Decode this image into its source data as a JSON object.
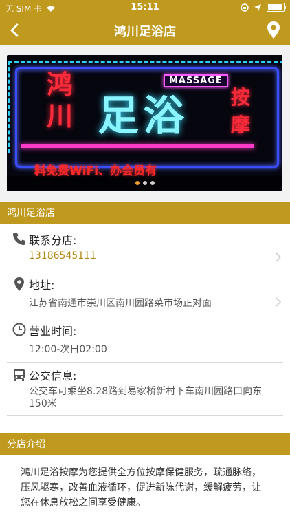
{
  "status_bar": {
    "carrier": "无 SIM 卡",
    "time": "15:11"
  },
  "nav": {
    "title": "鸿川足浴店"
  },
  "banner": {
    "sign_left": "鸿川",
    "sign_main": "足浴",
    "sign_right": "按摩",
    "massage_label": "MASSAGE",
    "ticker": "料免费WiFi、办会员有",
    "slides": 3,
    "active_slide": 1
  },
  "store_section": {
    "header": "鸿川足浴店",
    "contact": {
      "label": "联系分店:",
      "value": "13186545111"
    },
    "address": {
      "label": "地址:",
      "value": "江苏省南通市崇川区南川园路菜市场正对面"
    },
    "hours": {
      "label": "营业时间:",
      "value": "12:00-次日02:00"
    },
    "bus": {
      "label": "公交信息:",
      "value": "公交车可乘坐8.28路到易家桥新村下车南川园路口向东150米"
    }
  },
  "intro_section": {
    "header": "分店介绍",
    "text": "鸿川足浴按摩为您提供全方位按摩保健服务，疏通脉络，压风驱寒，改善血液循环，促进新陈代谢，缓解疲劳，让您在休息放松之间享受健康。"
  },
  "colors": {
    "accent": "#bf9a1f",
    "phone": "#b48a14"
  }
}
